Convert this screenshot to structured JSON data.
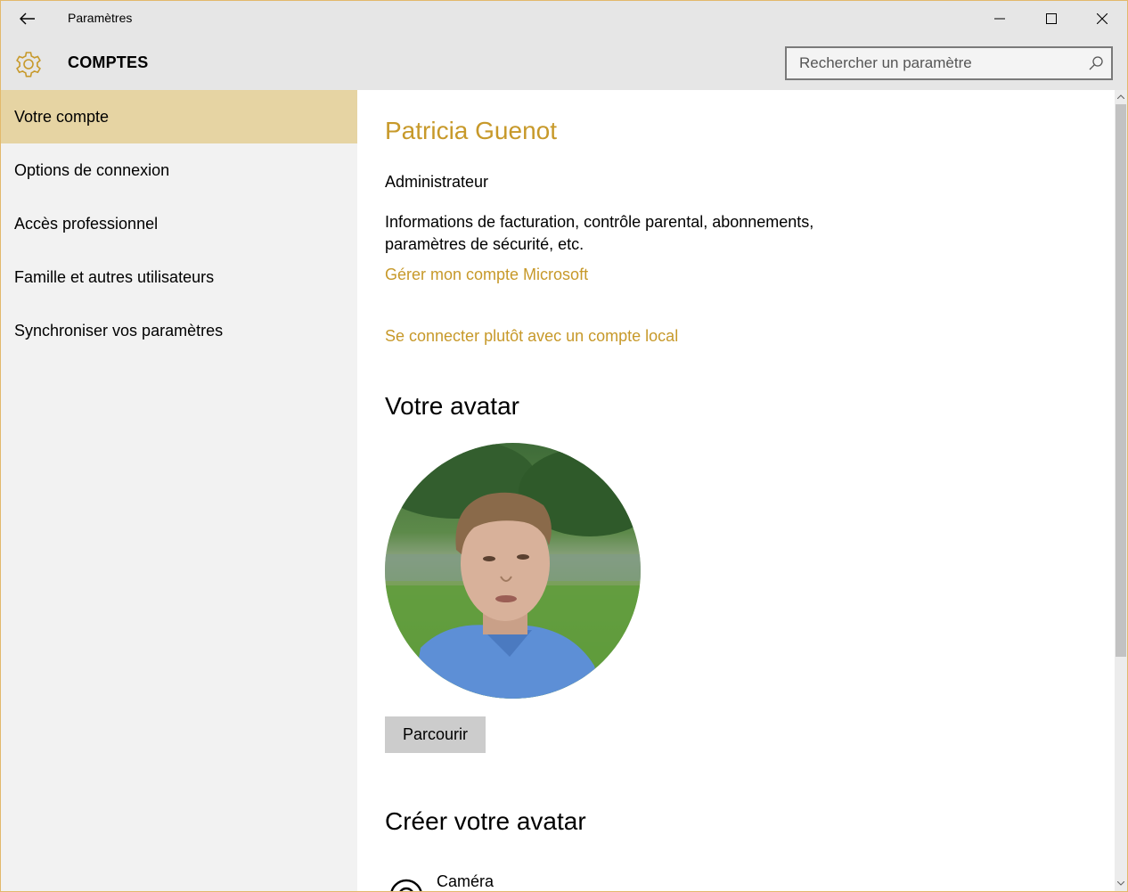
{
  "titlebar": {
    "app_title": "Paramètres",
    "back_icon": "back-arrow-icon",
    "minimize_icon": "minimize-icon",
    "maximize_icon": "maximize-icon",
    "close_icon": "close-icon"
  },
  "header": {
    "icon": "gear-icon",
    "title": "COMPTES",
    "search_placeholder": "Rechercher un paramètre",
    "search_icon": "search-icon"
  },
  "sidebar": {
    "items": [
      {
        "label": "Votre compte",
        "active": true
      },
      {
        "label": "Options de connexion",
        "active": false
      },
      {
        "label": "Accès professionnel",
        "active": false
      },
      {
        "label": "Famille et autres utilisateurs",
        "active": false
      },
      {
        "label": "Synchroniser vos paramètres",
        "active": false
      }
    ]
  },
  "account": {
    "name": "Patricia Guenot",
    "role": "Administrateur",
    "info": "Informations de facturation, contrôle parental, abonnements, paramètres de sécurité, etc.",
    "manage_link": "Gérer mon compte Microsoft",
    "local_link": "Se connecter plutôt avec un compte local"
  },
  "avatar_section": {
    "title": "Votre avatar",
    "browse_label": "Parcourir"
  },
  "create_section": {
    "title": "Créer votre avatar",
    "camera_label": "Caméra",
    "camera_icon": "camera-icon"
  },
  "colors": {
    "accent": "#c7992a",
    "nav_active": "#e6d4a3",
    "chrome": "#e6e6e6",
    "sidebar": "#f2f2f2"
  }
}
